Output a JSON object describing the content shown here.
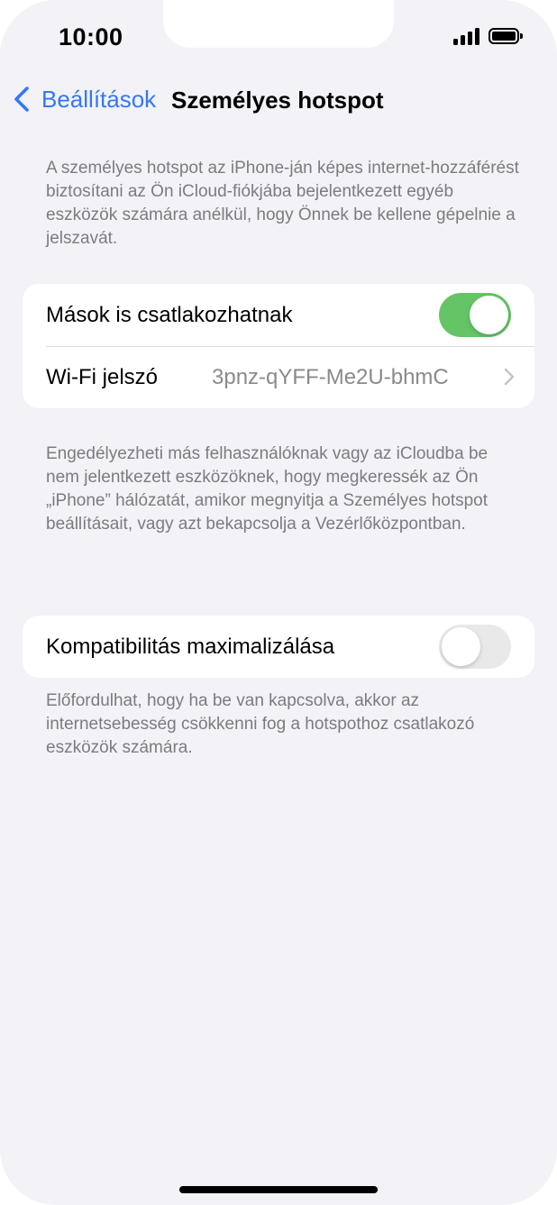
{
  "status_bar": {
    "time": "10:00",
    "signal_icon": "cellular-signal-icon",
    "battery_icon": "battery-full-icon"
  },
  "nav": {
    "back_label": "Beállítások",
    "back_icon": "chevron-left-icon",
    "title": "Személyes hotspot"
  },
  "intro_text": "A személyes hotspot az iPhone-ján képes internet-hozzáférést biztosítani az Ön iCloud-fiókjába bejelentkezett egyéb eszközök számára anélkül, hogy Önnek be kellene gépelnie a jelszavát.",
  "group1": {
    "allow_others_label": "Mások is csatlakozhatnak",
    "allow_others_on": true,
    "wifi_password_label": "Wi-Fi jelszó",
    "wifi_password_value": "3pnz-qYFF-Me2U-bhmC"
  },
  "group1_footer": "Engedélyezheti más felhasználóknak vagy az iCloudba be nem jelentkezett eszközöknek, hogy megkeressék az Ön „iPhone” hálózatát, amikor megnyitja a Személyes hotspot beállításait, vagy azt bekapcsolja a Vezérlőközpontban.",
  "group2": {
    "max_compat_label": "Kompatibilitás maximalizálása",
    "max_compat_on": false
  },
  "group2_footer": "Előfordulhat, hogy ha be van kapcsolva, akkor az internetsebesség csökkenni fog a hotspothoz csatlakozó eszközök számára.",
  "colors": {
    "accent": "#3478f6",
    "toggle_on": "#65c466",
    "toggle_off": "#e9e9ea",
    "background": "#f2f2f7"
  }
}
